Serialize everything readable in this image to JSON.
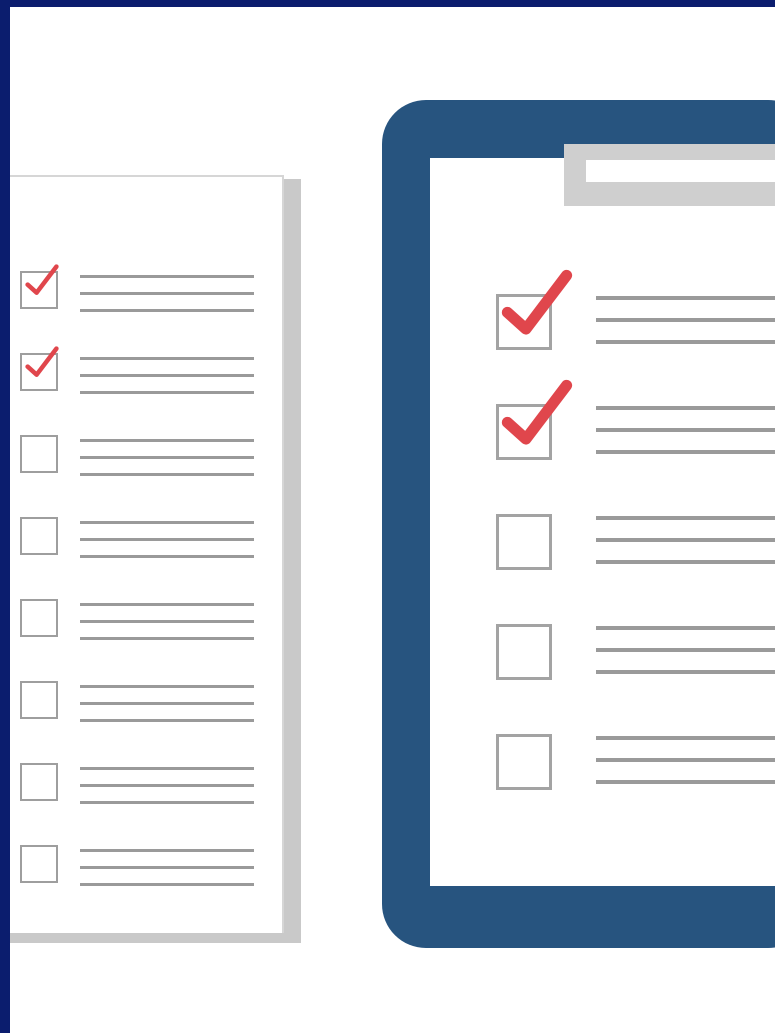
{
  "colors": {
    "border_background": "#0b1d6e",
    "clipboard_blue": "#27547f",
    "check_red": "#e0464c",
    "line_gray": "#9a9a9a",
    "box_gray": "#9e9e9e",
    "paper_shadow": "#c9c9c9"
  },
  "icons": {
    "check_mark": "check-icon",
    "empty_box": "checkbox-empty-icon"
  },
  "paper_list": {
    "items": [
      {
        "checked": true
      },
      {
        "checked": true
      },
      {
        "checked": false
      },
      {
        "checked": false
      },
      {
        "checked": false
      },
      {
        "checked": false
      },
      {
        "checked": false
      },
      {
        "checked": false
      }
    ]
  },
  "clipboard_list": {
    "items": [
      {
        "checked": true
      },
      {
        "checked": true
      },
      {
        "checked": false
      },
      {
        "checked": false
      },
      {
        "checked": false
      }
    ]
  }
}
